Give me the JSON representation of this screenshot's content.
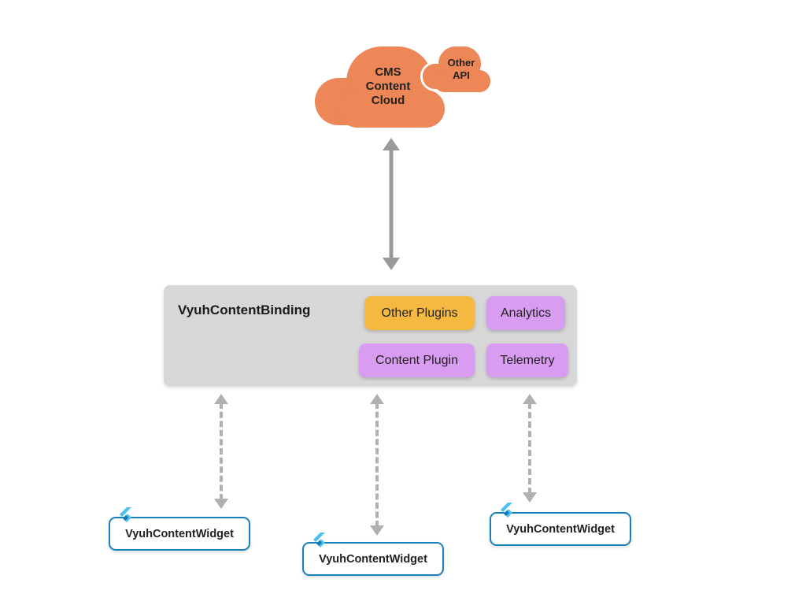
{
  "cloud": {
    "main_label": "CMS Content Cloud",
    "small_label": "Other API"
  },
  "binding": {
    "title": "VyuhContentBinding",
    "plugins": {
      "other": "Other Plugins",
      "analytics": "Analytics",
      "content": "Content Plugin",
      "telemetry": "Telemetry"
    }
  },
  "widgets": {
    "w1": "VyuhContentWidget",
    "w2": "VyuhContentWidget",
    "w3": "VyuhContentWidget"
  },
  "colors": {
    "cloud": "#ed8757",
    "plugin_orange": "#f5b942",
    "plugin_purple": "#d89cf0",
    "widget_border": "#1b7fb9",
    "arrow": "#9a9a9a",
    "arrow_dashed": "#b0b0b0",
    "binding_bg": "#d7d7d7"
  }
}
